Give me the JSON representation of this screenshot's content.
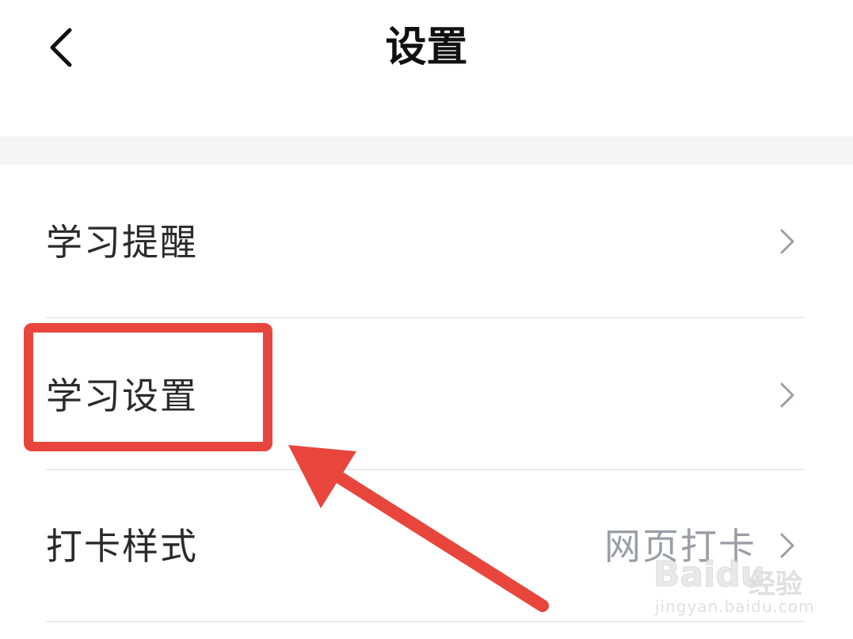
{
  "header": {
    "title": "设置",
    "back_icon": "chevron-left-icon"
  },
  "settings": {
    "items": [
      {
        "label": "学习提醒",
        "value": "",
        "icon": "chevron-right-icon"
      },
      {
        "label": "学习设置",
        "value": "",
        "icon": "chevron-right-icon"
      },
      {
        "label": "打卡样式",
        "value": "网页打卡",
        "icon": "chevron-right-icon"
      }
    ]
  },
  "annotation": {
    "highlight_color": "#e8463c",
    "target_item": "学习设置"
  },
  "watermark": {
    "brand": "Baidu",
    "brand_suffix": "经验",
    "url": "jingyan.baidu.com"
  },
  "colors": {
    "accent": "#e8463c",
    "text_primary": "#2a2a2a",
    "text_secondary": "#9a9ea6",
    "chevron": "#9a9ea6",
    "divider": "#ebebeb",
    "band": "#f5f5f5"
  }
}
